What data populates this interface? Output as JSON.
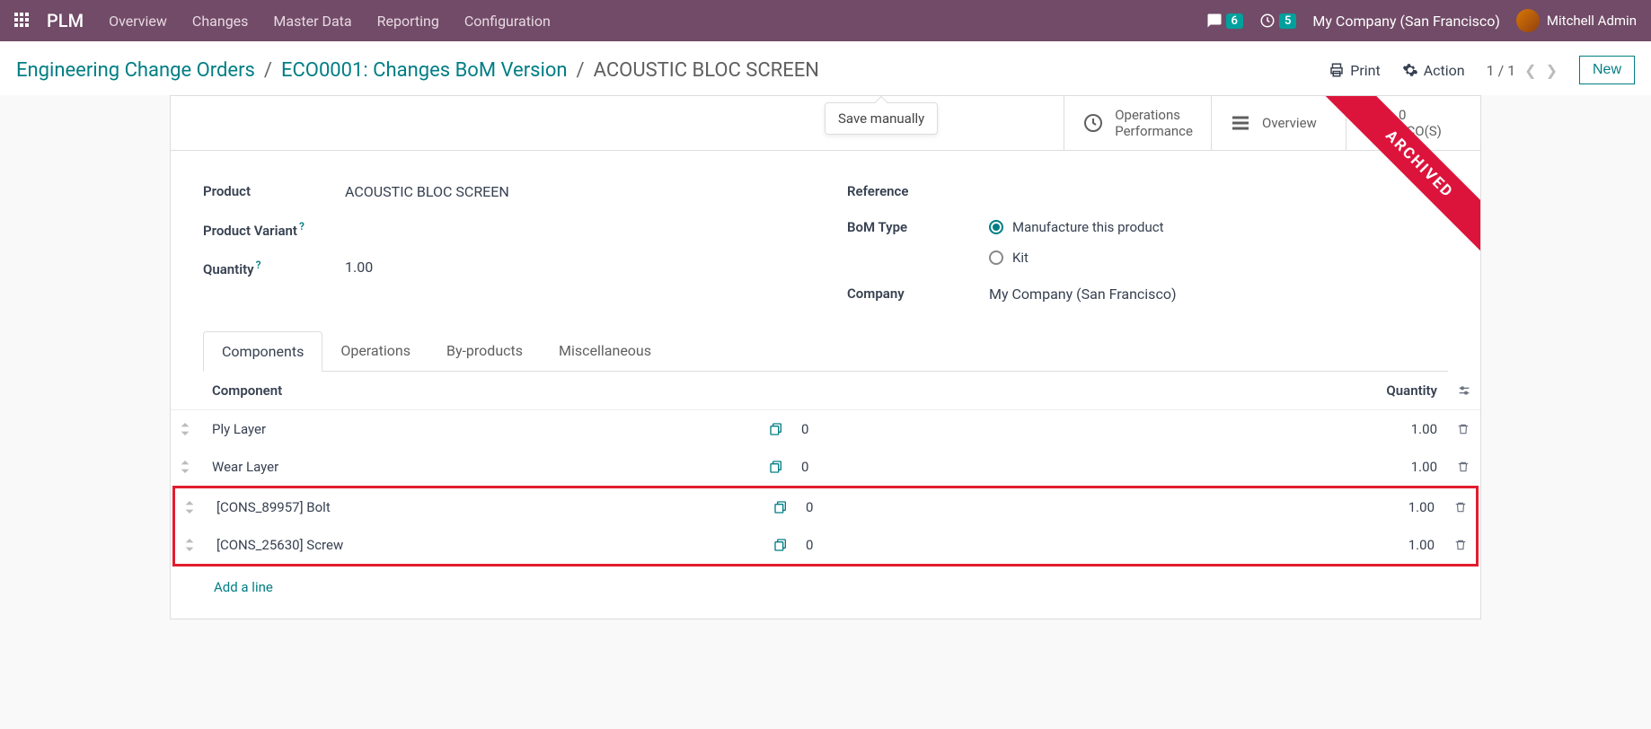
{
  "nav": {
    "brand": "PLM",
    "items": [
      "Overview",
      "Changes",
      "Master Data",
      "Reporting",
      "Configuration"
    ],
    "messages_badge": "6",
    "activities_badge": "5",
    "company": "My Company (San Francisco)",
    "user": "Mitchell Admin"
  },
  "breadcrumb": {
    "root": "Engineering Change Orders",
    "eco": "ECO0001: Changes BoM Version",
    "current": "ACOUSTIC BLOC SCREEN"
  },
  "actions": {
    "print": "Print",
    "action": "Action",
    "pager": "1 / 1",
    "new": "New"
  },
  "tooltip": "Save manually",
  "stat_buttons": {
    "ops_perf_1": "Operations",
    "ops_perf_2": "Performance",
    "overview": "Overview",
    "eco_count": "0",
    "eco_label": "ECO(S)"
  },
  "ribbon": "ARCHIVED",
  "fields": {
    "product_label": "Product",
    "product_value": "ACOUSTIC BLOC SCREEN",
    "variant_label": "Product Variant",
    "quantity_label": "Quantity",
    "quantity_value": "1.00",
    "reference_label": "Reference",
    "bom_type_label": "BoM Type",
    "bom_type_opt1": "Manufacture this product",
    "bom_type_opt2": "Kit",
    "company_label": "Company",
    "company_value": "My Company (San Francisco)"
  },
  "tabs": [
    "Components",
    "Operations",
    "By-products",
    "Miscellaneous"
  ],
  "table": {
    "col_component": "Component",
    "col_quantity": "Quantity",
    "rows": [
      {
        "name": "Ply Layer",
        "catalog_qty": "0",
        "qty": "1.00"
      },
      {
        "name": "Wear Layer",
        "catalog_qty": "0",
        "qty": "1.00"
      },
      {
        "name": "[CONS_89957] Bolt",
        "catalog_qty": "0",
        "qty": "1.00"
      },
      {
        "name": "[CONS_25630] Screw",
        "catalog_qty": "0",
        "qty": "1.00"
      }
    ],
    "add_line": "Add a line"
  }
}
